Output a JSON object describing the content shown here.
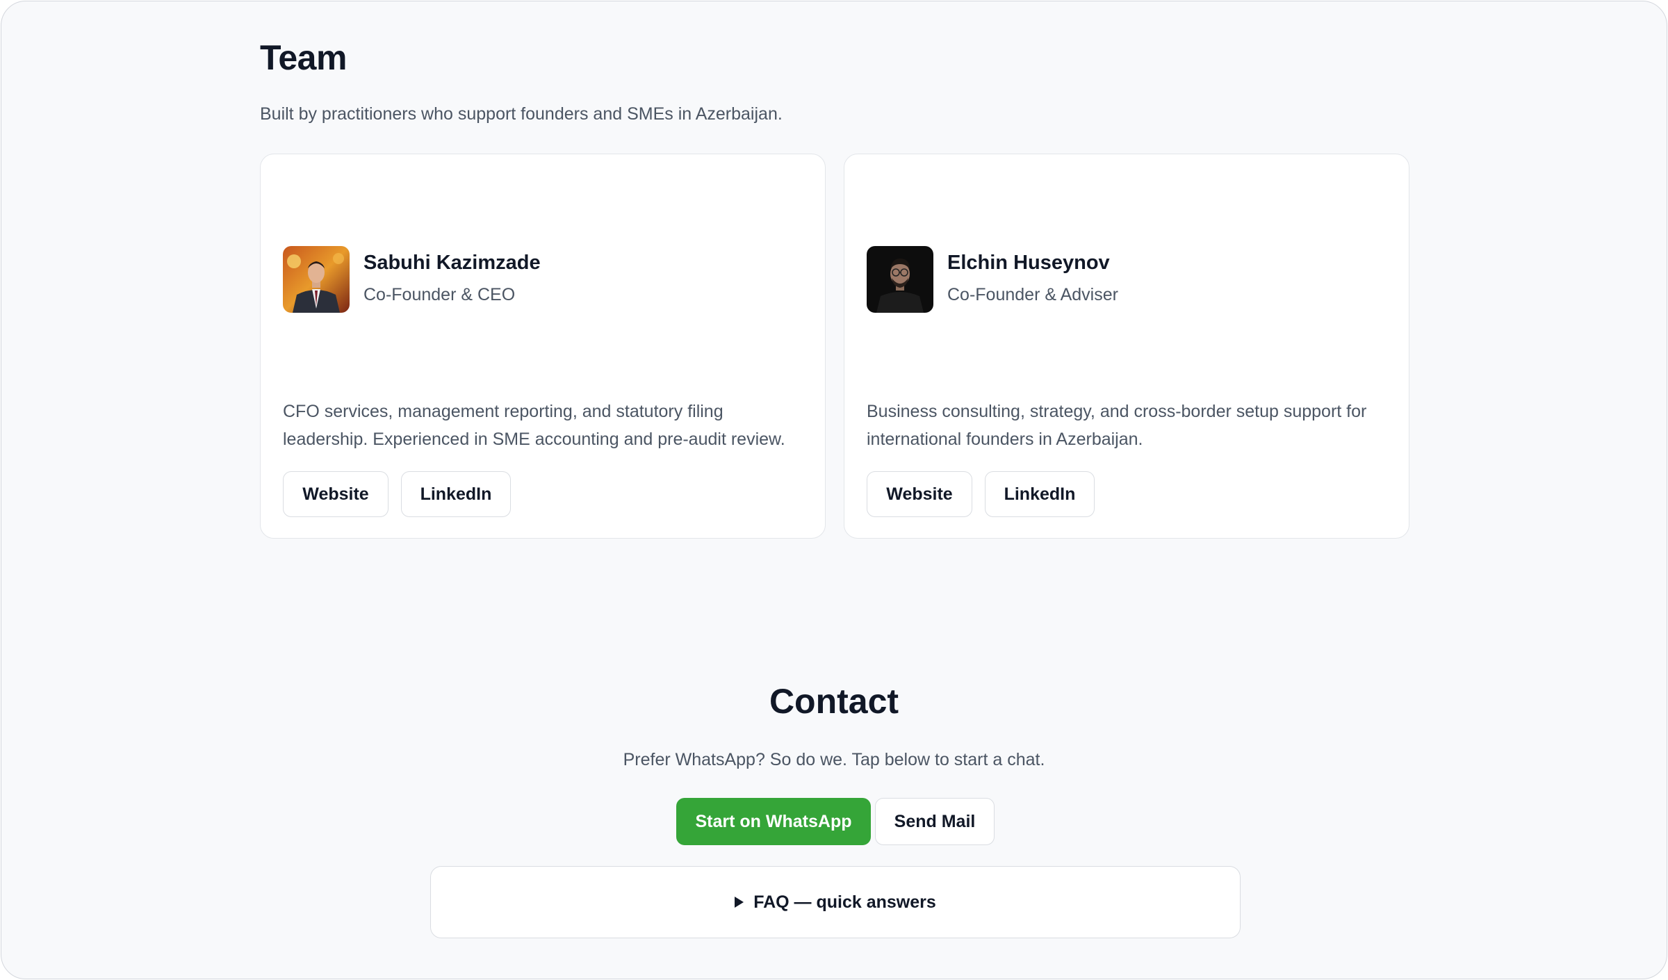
{
  "team": {
    "title": "Team",
    "subtitle": "Built by practitioners who support founders and SMEs in Azerbaijan.",
    "members": [
      {
        "name": "Sabuhi Kazimzade",
        "role": "Co-Founder & CEO",
        "bio": "CFO services, management reporting, and statutory filing leadership. Experienced in SME accounting and pre-audit review.",
        "website_label": "Website",
        "linkedin_label": "LinkedIn"
      },
      {
        "name": "Elchin Huseynov",
        "role": "Co-Founder & Adviser",
        "bio": "Business consulting, strategy, and cross-border setup support for international founders in Azerbaijan.",
        "website_label": "Website",
        "linkedin_label": "LinkedIn"
      }
    ]
  },
  "contact": {
    "title": "Contact",
    "subtitle": "Prefer WhatsApp? So do we. Tap below to start a chat.",
    "whatsapp_label": "Start on WhatsApp",
    "mail_label": "Send Mail",
    "faq_label": "FAQ — quick answers"
  },
  "colors": {
    "background": "#f8f9fb",
    "whatsapp_green": "#35a538",
    "heading": "#111827",
    "muted_text": "#4b5563"
  },
  "icons": {
    "faq_toggle": "triangle-right-icon"
  }
}
